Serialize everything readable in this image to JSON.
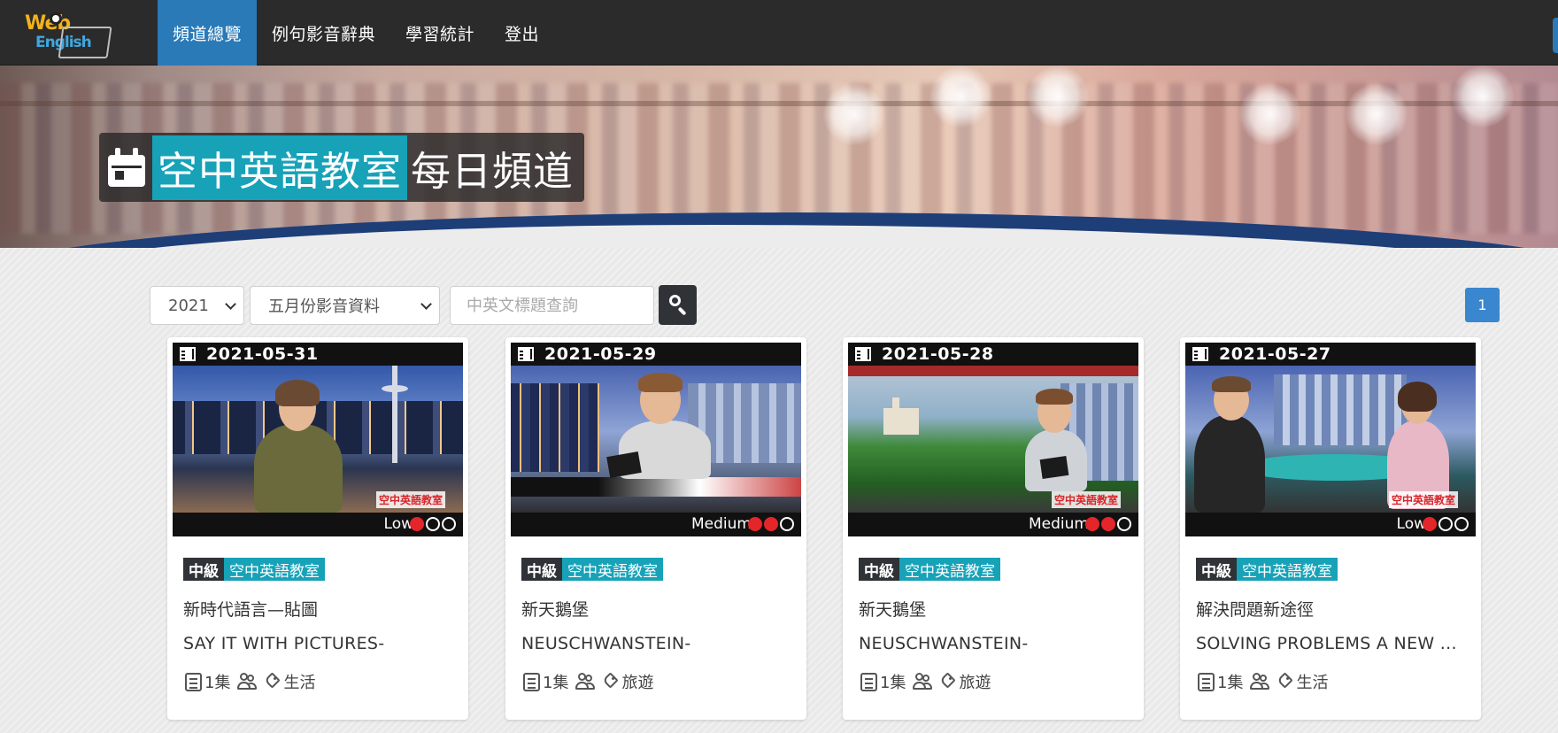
{
  "nav": {
    "items": [
      {
        "label": "頻道總覽",
        "active": true
      },
      {
        "label": "例句影音辭典",
        "active": false
      },
      {
        "label": "學習統計",
        "active": false
      },
      {
        "label": "登出",
        "active": false
      }
    ]
  },
  "banner": {
    "title_highlight": "空中英語教室",
    "title_rest": "每日頻道",
    "icon": "calendar-icon"
  },
  "filters": {
    "year": "2021",
    "month": "五月份影音資料",
    "search_placeholder": "中英文標題查詢",
    "page": "1"
  },
  "colors": {
    "nav_bg": "#2b2b2b",
    "accent_blue": "#2a7ab8",
    "teal": "#17a2b8",
    "level_dot": "#e3262a"
  },
  "cards": [
    {
      "date": "2021-05-31",
      "level": "Low",
      "level_dots": 1,
      "badge_level": "中級",
      "badge_channel": "空中英語教室",
      "title_zh": "新時代語言—貼圖",
      "title_en": "SAY IT WITH PICTURES-",
      "episodes": "1集",
      "category": "生活"
    },
    {
      "date": "2021-05-29",
      "level": "Medium",
      "level_dots": 2,
      "badge_level": "中級",
      "badge_channel": "空中英語教室",
      "title_zh": "新天鵝堡",
      "title_en": "NEUSCHWANSTEIN-",
      "episodes": "1集",
      "category": "旅遊"
    },
    {
      "date": "2021-05-28",
      "level": "Medium",
      "level_dots": 2,
      "badge_level": "中級",
      "badge_channel": "空中英語教室",
      "title_zh": "新天鵝堡",
      "title_en": "NEUSCHWANSTEIN-",
      "episodes": "1集",
      "category": "旅遊"
    },
    {
      "date": "2021-05-27",
      "level": "Low",
      "level_dots": 1,
      "badge_level": "中級",
      "badge_channel": "空中英語教室",
      "title_zh": "解決問題新途徑",
      "title_en": "SOLVING PROBLEMS A NEW ...",
      "episodes": "1集",
      "category": "生活"
    }
  ]
}
